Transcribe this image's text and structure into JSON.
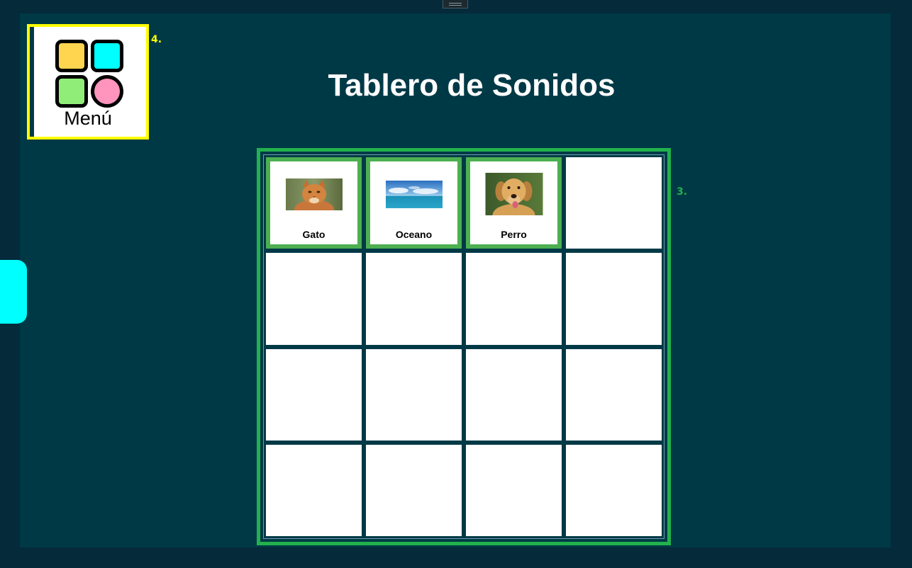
{
  "page": {
    "title": "Tablero de Sonidos"
  },
  "menu": {
    "label": "Menú",
    "icon": "app-grid-icon",
    "tile_colors": [
      "#ffd54f",
      "#00ffff",
      "#90ee78",
      "#ff94bc"
    ]
  },
  "annotations": {
    "menu_marker": "4.",
    "board_marker": "3."
  },
  "board": {
    "rows": 4,
    "columns": 4,
    "frame_color": "#22b14c",
    "tiles": [
      {
        "label": "Gato",
        "image": "cat-photo"
      },
      {
        "label": "Oceano",
        "image": "ocean-photo"
      },
      {
        "label": "Perro",
        "image": "dog-photo"
      }
    ]
  },
  "colors": {
    "background": "#003946",
    "outer": "#052a3a",
    "accent_yellow": "#ffff00",
    "side_tab": "#00ffff",
    "tile_border": "#4caf50"
  }
}
